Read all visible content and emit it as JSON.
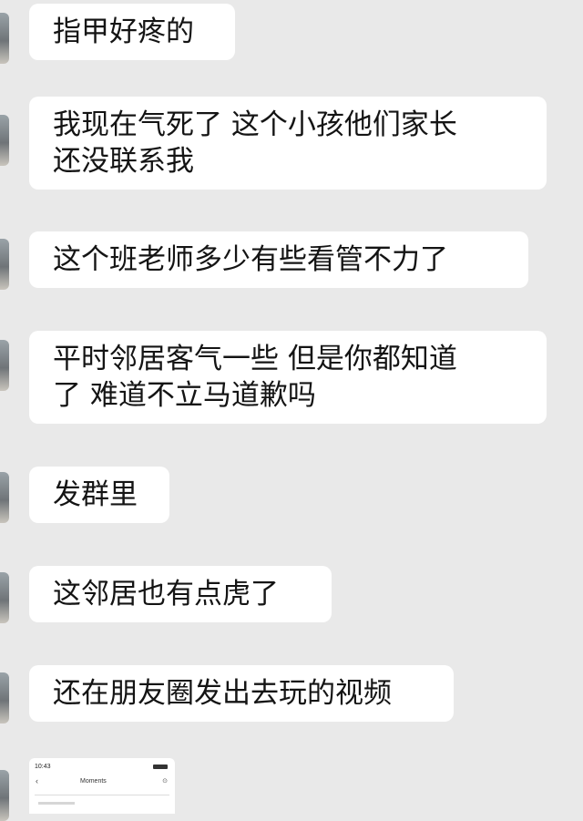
{
  "chat": {
    "messages": [
      {
        "lines": [
          "指甲好疼的"
        ]
      },
      {
        "lines": [
          "我现在气死了 这个小孩他们家长",
          "还没联系我"
        ]
      },
      {
        "lines": [
          "这个班老师多少有些看管不力了"
        ]
      },
      {
        "lines": [
          "平时邻居客气一些 但是你都知道",
          "了 难道不立马道歉吗"
        ]
      },
      {
        "lines": [
          "发群里"
        ]
      },
      {
        "lines": [
          "这邻居也有点虎了"
        ]
      },
      {
        "lines": [
          "还在朋友圈发出去玩的视频"
        ]
      }
    ]
  },
  "thumbnail": {
    "status_time": "10:43",
    "back_icon": "chevron-left-icon",
    "title": "Moments",
    "more_icon": "more-icon",
    "more_glyph": "⊙"
  },
  "colors": {
    "background": "#e9e9e9",
    "bubble": "#ffffff",
    "text": "#141414"
  }
}
